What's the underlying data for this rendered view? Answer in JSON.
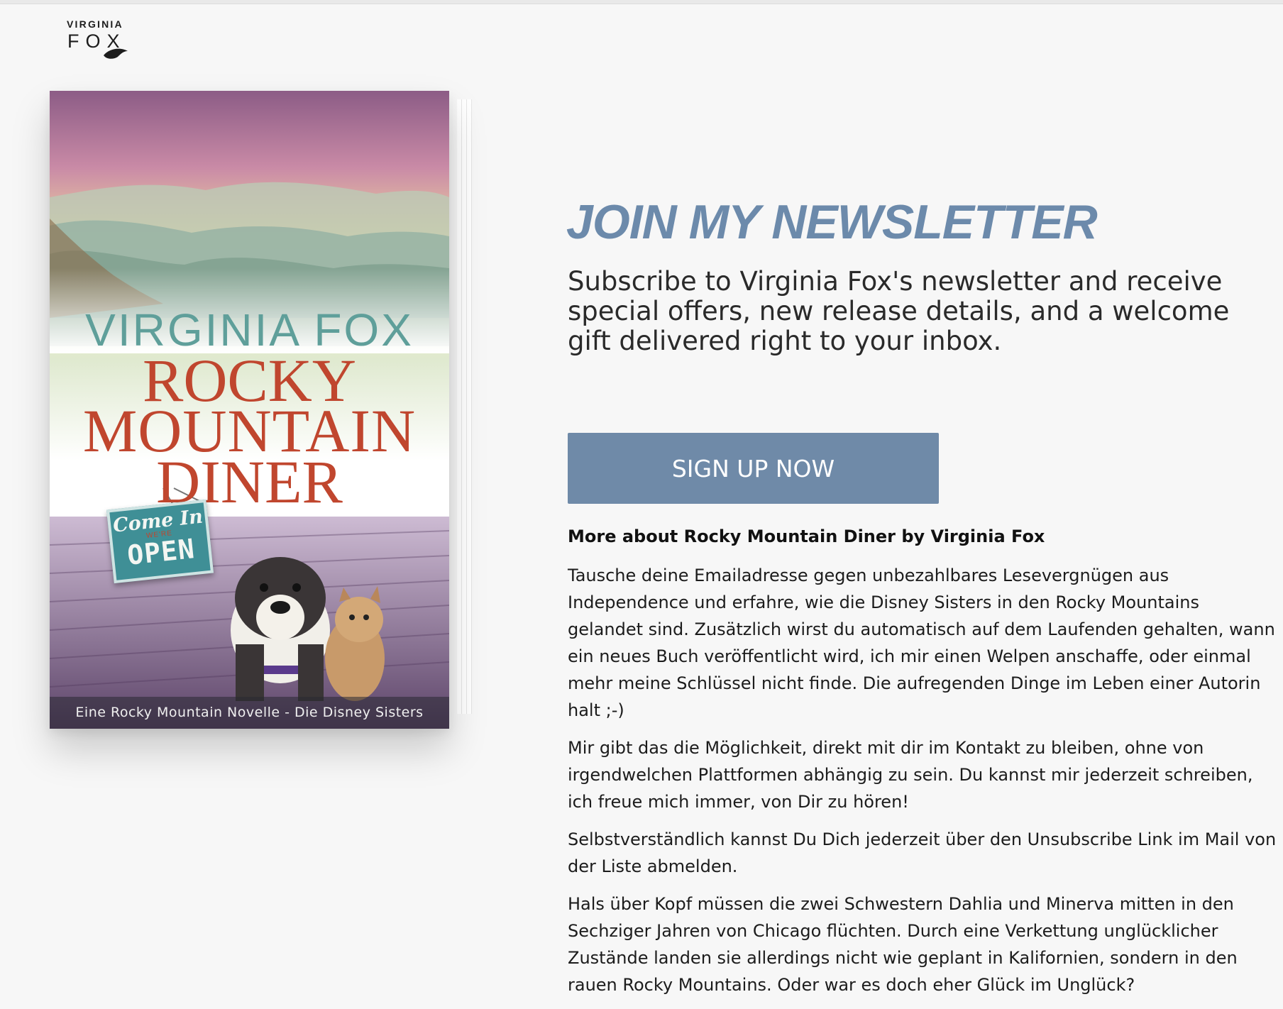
{
  "logo": {
    "top_text": "VIRGINIA",
    "bottom_text": "FOX"
  },
  "book": {
    "author": "VIRGINIA FOX",
    "title_lines": [
      "ROCKY",
      "MOUNTAIN",
      "DINER"
    ],
    "sign": {
      "line1": "Come In",
      "line2": "WE'RE",
      "line3": "OPEN"
    },
    "tagline": "Eine Rocky Mountain Novelle - Die Disney Sisters"
  },
  "main": {
    "headline": "JOIN MY NEWSLETTER",
    "subtitle": "Subscribe to Virginia Fox's newsletter and receive special offers, new release details, and a welcome gift delivered right to your inbox.",
    "button_label": "SIGN UP NOW",
    "more_heading": "More about Rocky Mountain Diner by Virginia Fox",
    "paragraphs": [
      "Tausche deine Emailadresse gegen unbezahlbares Lesevergnügen aus Independence und erfahre, wie die Disney Sisters in den Rocky Mountains gelandet sind. Zusätzlich wirst du automatisch auf dem Laufenden gehalten, wann ein neues Buch veröffentlicht wird, ich mir einen Welpen anschaffe, oder einmal mehr meine Schlüssel nicht finde. Die aufregenden Dinge im Leben einer Autorin halt ;-)",
      "Mir gibt das die Möglichkeit, direkt mit dir im Kontakt zu bleiben, ohne von irgendwelchen Plattformen abhängig zu sein. Du kannst mir jederzeit schreiben, ich freue mich immer, von Dir zu hören!",
      "Selbstverständlich kannst Du Dich jederzeit über den Unsubscribe Link im Mail von der Liste abmelden.",
      "Hals über Kopf müssen die zwei Schwestern Dahlia und Minerva mitten in den Sechziger Jahren von Chicago flüchten. Durch eine Verkettung unglücklicher Zustände landen sie allerdings nicht wie geplant in Kalifornien, sondern in den rauen Rocky Mountains. Oder war es doch eher Glück im Unglück?"
    ]
  },
  "colors": {
    "background": "#f7f7f7",
    "accent": "#6c8aab",
    "button": "#6f8aa8",
    "cover_title": "#c0462e",
    "cover_author": "#5f9f9a"
  }
}
